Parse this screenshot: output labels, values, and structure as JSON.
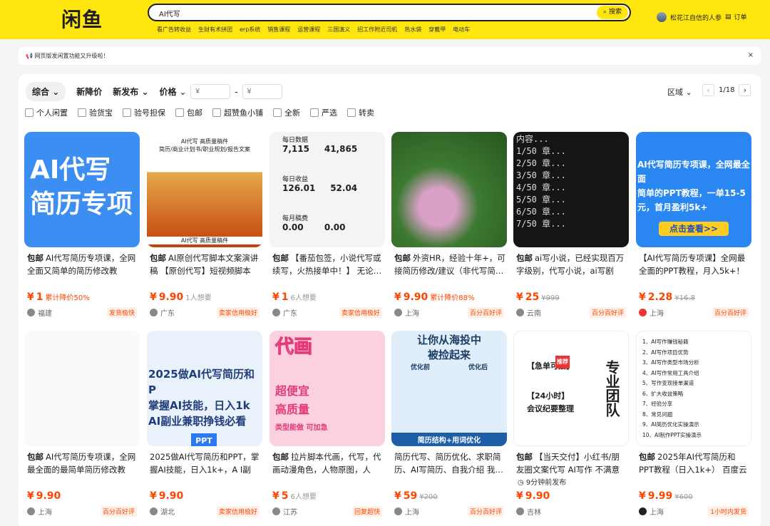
{
  "header": {
    "logo": "闲鱼",
    "search_value": "AI代写",
    "search_button": "搜索",
    "hot_words": [
      "看广告转收益",
      "生财有术拼团",
      "erp系统",
      "销售课程",
      "运营课程",
      "三国演义",
      "招工作附近司机",
      "热水袋",
      "穿戴甲",
      "电动车"
    ],
    "user_name": "松花江自信的人参",
    "order_label": "订单"
  },
  "notice": {
    "text": "网页版发闲置功能又升级啦！",
    "close": "×"
  },
  "sort": {
    "tabs": [
      "综合",
      "新降价",
      "新发布",
      "价格"
    ],
    "price_min": "¥",
    "price_max": "¥",
    "region": "区域",
    "page": "1/18"
  },
  "filters": [
    "个人闲置",
    "验货宝",
    "验号担保",
    "包邮",
    "超赞鱼小铺",
    "全新",
    "严选",
    "转卖"
  ],
  "row1": [
    {
      "title": "AI代写简历专项课，全网全面又简单的简历修改教程，…",
      "badge": "包邮",
      "price": "1",
      "extra": "累计降价50%",
      "loc": "福建",
      "seller": "发货极快"
    },
    {
      "title": "AI原创代写脚本文案演讲稿 【原创代写】短视频脚本 /…",
      "badge": "包邮",
      "price": "9.90",
      "extra": "1人想要",
      "loc": "广东",
      "seller": "卖家信用极好"
    },
    {
      "title": "【番茄包签，小说代写或续写，火热接单中！】 无论…",
      "badge": "包邮",
      "price": "1",
      "extra": "6人想要",
      "loc": "广东",
      "seller": "卖家信用极好"
    },
    {
      "title": "外资HR，经验十年+，可接简历修改/建议（非代写简…",
      "badge": "包邮",
      "price": "9.90",
      "extra": "累计降价88%",
      "loc": "上海",
      "seller": "百分百好评"
    },
    {
      "title": "ai写小说，已经实现百万字级别，代写小说，ai写剧情…",
      "badge": "包邮",
      "price": "25",
      "extra": "¥999",
      "loc": "云南",
      "seller": "百分百好评"
    },
    {
      "title": "【AI代写简历专项课】全网最全面的PPT教程，月入5k+！ 【…",
      "badge": "",
      "price": "2.28",
      "extra": "¥16.8",
      "loc": "上海",
      "seller": "百分百好评"
    }
  ],
  "row2": [
    {
      "title": "AI代写简历专项课，全网最全面的最简单简历修改教程…",
      "badge": "包邮",
      "price": "9.90",
      "extra": "",
      "loc": "上海",
      "seller": "百分百好评"
    },
    {
      "title": "2025做AI代写简历和PPT，掌握AI技能，日入1k+，A I副业…",
      "badge": "",
      "price": "9.90",
      "extra": "",
      "loc": "湖北",
      "seller": "卖家信用极好"
    },
    {
      "title": "拉片脚本代画，代写，代画动漫角色，人物原图，人物…",
      "badge": "包邮",
      "price": "5",
      "extra": "6人想要",
      "loc": "江苏",
      "seller": "回复超快"
    },
    {
      "title": "简历代写、简历优化、求职简历、AI写简历、自我介绍 我…",
      "badge": "",
      "price": "59",
      "extra": "¥200",
      "loc": "上海",
      "seller": "百分百好评"
    },
    {
      "title": "【当天交付】小红书/朋友圈文案代写 AI写作 不满意改…",
      "badge": "包邮",
      "price": "9.90",
      "extra": "",
      "loc": "吉林",
      "seller": ""
    },
    {
      "title": "2025年AI代写简历和PPT教程（日入1k+） 百度云盘…",
      "badge": "包邮",
      "price": "9.99",
      "extra": "¥600",
      "loc": "上海",
      "seller": "1小时内发货"
    }
  ],
  "img_texts": {
    "c1": "AI代写 简历专项",
    "c2a": "AI代写 高质量稿件",
    "c2b": "简历/商业计划书/职业规划/报告文案",
    "c2c": "AI代写 高质量稿件",
    "c3": [
      "每日数据",
      "7,115",
      "41,865",
      "每日收益",
      "126.01",
      "52.04",
      "每月稿费",
      "0.00",
      "0.00"
    ],
    "c5": [
      "内容...",
      "1/50 章...",
      "2/50 章...",
      "3/50 章...",
      "4/50 章...",
      "5/50 章...",
      "6/50 章...",
      "7/50 章..."
    ],
    "c6": [
      "AI代写简历专项课，全网最全面",
      "简单的PPT教程，一单15-5",
      "元，首月盈利5k+",
      "点击查看>>"
    ],
    "c8": [
      "2025做AI代写简历和P",
      "掌握AI技能，日入1k",
      "AI副业兼职挣钱必看",
      "PPT"
    ],
    "c9": [
      "代画",
      "超便宜",
      "高质量",
      "类型能做 可加急"
    ],
    "c10": [
      "让你从海投中",
      "被捡起来",
      "优化前",
      "优化后",
      "简历结构+用词优化"
    ],
    "c11": [
      "【急单可接】",
      "【24小时】",
      "会议纪要整理",
      "推荐",
      "专业团队"
    ],
    "c12": [
      "1、AI写作赚钱秘籍",
      "2、AI写作项目优势",
      "3、AI写作类型市场分析",
      "4、AI写作常用工具介绍",
      "5、写作变现接单渠道",
      "6、扩大收益策略",
      "7、经验分享",
      "8、常见问题",
      "9、AI简历优化实操演示",
      "10、AI制作PPT实操演示"
    ],
    "c11_time": "9分钟前发布"
  }
}
